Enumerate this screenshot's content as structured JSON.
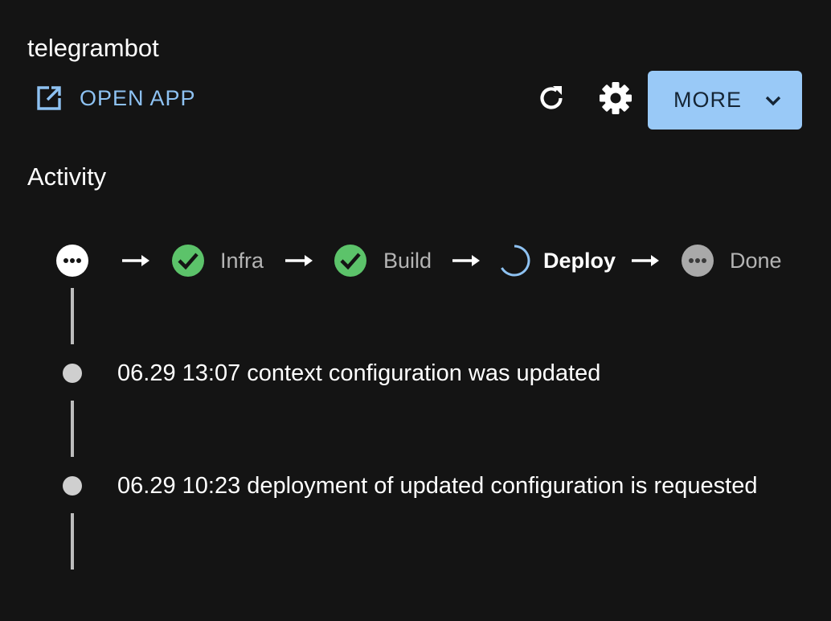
{
  "app": {
    "title": "telegrambot"
  },
  "toolbar": {
    "open_app_label": "OPEN APP",
    "open_app_icon": "external-link-icon",
    "refresh_icon": "refresh-icon",
    "settings_icon": "gear-icon",
    "more_label": "MORE",
    "more_icon": "chevron-down-icon",
    "accent_color": "#8ec2f2",
    "more_bg_color": "#99c9f7"
  },
  "activity": {
    "title": "Activity",
    "pipeline": {
      "stages": [
        {
          "label": "",
          "status": "pending"
        },
        {
          "label": "Infra",
          "status": "success"
        },
        {
          "label": "Build",
          "status": "success"
        },
        {
          "label": "Deploy",
          "status": "in-progress"
        },
        {
          "label": "Done",
          "status": "pending"
        }
      ],
      "success_color": "#5cc36a"
    },
    "events": [
      {
        "text": "06.29 13:07 context configuration was updated"
      },
      {
        "text": "06.29 10:23 deployment of updated configuration is requested"
      }
    ]
  }
}
